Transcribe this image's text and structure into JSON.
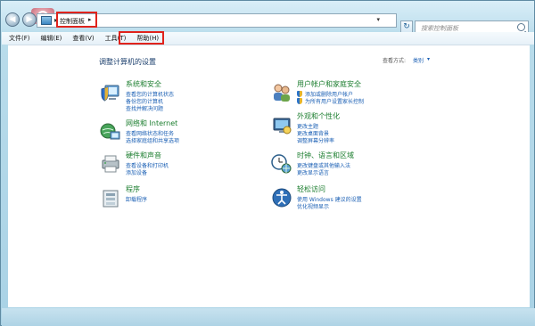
{
  "window": {
    "address": {
      "breadcrumb": "控制面板",
      "search_placeholder": "搜索控制面板"
    }
  },
  "menu": [
    "文件(F)",
    "编辑(E)",
    "查看(V)",
    "工具(T)",
    "帮助(H)"
  ],
  "main": {
    "title": "调整计算机的设置",
    "view_by_label": "查看方式:",
    "view_by_value": "类别"
  },
  "categories_left": [
    {
      "title": "系统和安全",
      "icon": "shield-computer-icon",
      "links": [
        "查看您的计算机状态",
        "备份您的计算机",
        "查找并解决问题"
      ]
    },
    {
      "title": "网络和 Internet",
      "icon": "network-globe-icon",
      "links": [
        "查看网络状态和任务",
        "选择家庭组和共享选项"
      ]
    },
    {
      "title": "硬件和声音",
      "icon": "printer-icon",
      "links": [
        "查看设备和打印机",
        "添加设备"
      ]
    },
    {
      "title": "程序",
      "icon": "programs-icon",
      "links": [
        "卸载程序"
      ]
    }
  ],
  "categories_right": [
    {
      "title": "用户帐户和家庭安全",
      "icon": "users-icon",
      "links": [
        "添加或删除用户帐户",
        "为所有用户设置家长控制"
      ]
    },
    {
      "title": "外观和个性化",
      "icon": "appearance-icon",
      "links": [
        "更改主题",
        "更改桌面背景",
        "调整屏幕分辨率"
      ]
    },
    {
      "title": "时钟、语言和区域",
      "icon": "clock-globe-icon",
      "links": [
        "更改键盘或其他输入法",
        "更改显示语言"
      ]
    },
    {
      "title": "轻松访问",
      "icon": "accessibility-icon",
      "links": [
        "使用 Windows 建议的设置",
        "优化视频显示"
      ]
    }
  ],
  "colors": {
    "category_title": "#1c7e2f",
    "link": "#1a5fb4",
    "highlight": "#e0231c"
  }
}
